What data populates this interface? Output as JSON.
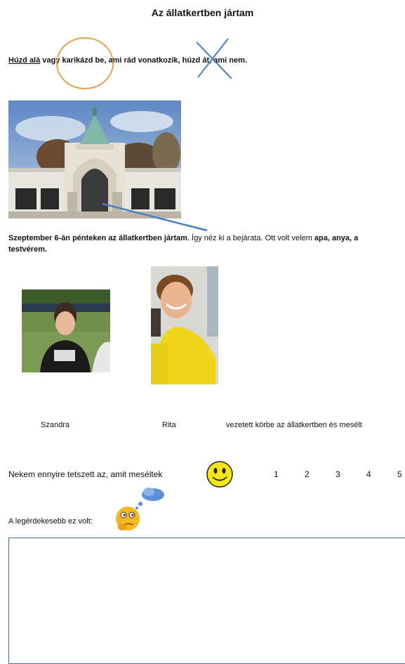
{
  "title": "Az állatkertben jártam",
  "instruction": {
    "part1": "Húzd alá",
    "part2": " vagy ",
    "part3": "karikázd be",
    "part4": ", ami rád vonatkozik, ",
    "part5": "húzd át",
    "part6": ", ami nem."
  },
  "story": {
    "s1": "Szeptember 6-án pénteken az állatkertben jártam",
    "s2": ". Így néz ki a bejárata. Ott volt velem ",
    "s3": "apa, anya, a",
    "s4": "testvérem."
  },
  "guides": {
    "guide1": "Szandra",
    "guide2": "Rita",
    "tail": "vezetett körbe az állatkertben és mesélt"
  },
  "rating": {
    "text": "Nekem ennyire tetszett az, amit meséltek",
    "numbers": [
      "1",
      "2",
      "3",
      "4",
      "5"
    ]
  },
  "question": "A legérdekesebb ez volt:",
  "icons": {
    "smiley": "smiley-face-icon",
    "thinking": "thinking-face-icon"
  },
  "colors": {
    "circle": "#e8a050",
    "strike": "#4a7fc0",
    "box": "#4a6b90"
  }
}
